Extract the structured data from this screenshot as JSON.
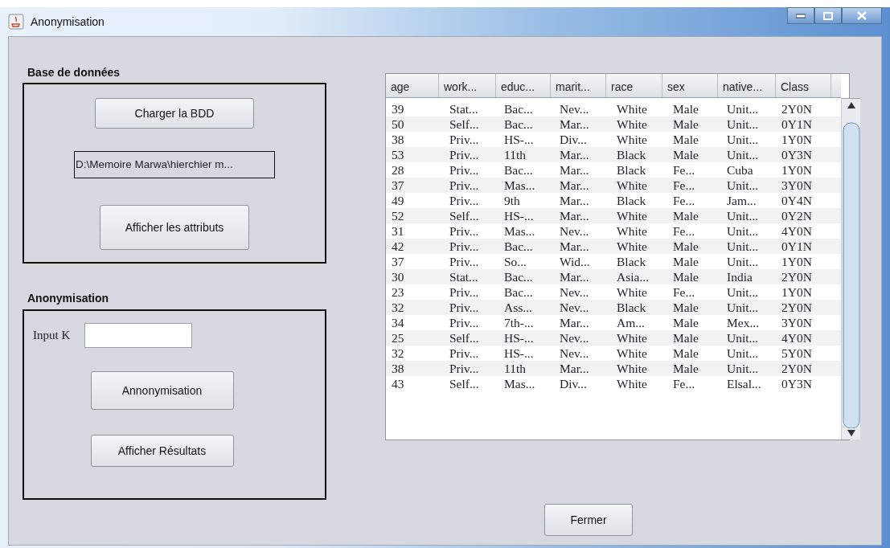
{
  "window": {
    "title": "Anonymisation"
  },
  "database_panel": {
    "title": "Base de données",
    "load_button": "Charger la BDD",
    "path": "D:\\Memoire Marwa\\hierchier m...",
    "attributes_button": "Afficher les attributs"
  },
  "anonymisation_panel": {
    "title": "Anonymisation",
    "k_label": "Input K",
    "anonymise_button": "Annonymisation",
    "results_button": "Afficher Résultats"
  },
  "table": {
    "columns": [
      "age",
      "work...",
      "educ...",
      "marit...",
      "race",
      "sex",
      "native...",
      "Class"
    ],
    "rows": [
      [
        "39",
        "Stat...",
        "Bac...",
        "Nev...",
        "White",
        "Male",
        "Unit...",
        "2Y0N"
      ],
      [
        "50",
        "Self...",
        "Bac...",
        "Mar...",
        "White",
        "Male",
        "Unit...",
        "0Y1N"
      ],
      [
        "38",
        "Priv...",
        "HS-...",
        "Div...",
        "White",
        "Male",
        "Unit...",
        "1Y0N"
      ],
      [
        "53",
        "Priv...",
        "11th",
        "Mar...",
        "Black",
        "Male",
        "Unit...",
        "0Y3N"
      ],
      [
        "28",
        "Priv...",
        "Bac...",
        "Mar...",
        "Black",
        "Fe...",
        "Cuba",
        "1Y0N"
      ],
      [
        "37",
        "Priv...",
        "Mas...",
        "Mar...",
        "White",
        "Fe...",
        "Unit...",
        "3Y0N"
      ],
      [
        "49",
        "Priv...",
        "9th",
        "Mar...",
        "Black",
        "Fe...",
        "Jam...",
        "0Y4N"
      ],
      [
        "52",
        "Self...",
        "HS-...",
        "Mar...",
        "White",
        "Male",
        "Unit...",
        "0Y2N"
      ],
      [
        "31",
        "Priv...",
        "Mas...",
        "Nev...",
        "White",
        "Fe...",
        "Unit...",
        "4Y0N"
      ],
      [
        "42",
        "Priv...",
        "Bac...",
        "Mar...",
        "White",
        "Male",
        "Unit...",
        "0Y1N"
      ],
      [
        "37",
        "Priv...",
        "So...",
        "Wid...",
        "Black",
        "Male",
        "Unit...",
        "1Y0N"
      ],
      [
        "30",
        "Stat...",
        "Bac...",
        "Mar...",
        "Asia...",
        "Male",
        "India",
        "2Y0N"
      ],
      [
        "23",
        "Priv...",
        "Bac...",
        "Nev...",
        "White",
        "Fe...",
        "Unit...",
        "1Y0N"
      ],
      [
        "32",
        "Priv...",
        "Ass...",
        "Nev...",
        "Black",
        "Male",
        "Unit...",
        "2Y0N"
      ],
      [
        "34",
        "Priv...",
        "7th-...",
        "Mar...",
        "Am...",
        "Male",
        "Mex...",
        "3Y0N"
      ],
      [
        "25",
        "Self...",
        "HS-...",
        "Nev...",
        "White",
        "Male",
        "Unit...",
        "4Y0N"
      ],
      [
        "32",
        "Priv...",
        "HS-...",
        "Nev...",
        "White",
        "Male",
        "Unit...",
        "5Y0N"
      ],
      [
        "38",
        "Priv...",
        "11th",
        "Mar...",
        "White",
        "Male",
        "Unit...",
        "2Y0N"
      ],
      [
        "43",
        "Self...",
        "Mas...",
        "Div...",
        "White",
        "Fe...",
        "Elsal...",
        "0Y3N"
      ]
    ]
  },
  "close_button": "Fermer"
}
